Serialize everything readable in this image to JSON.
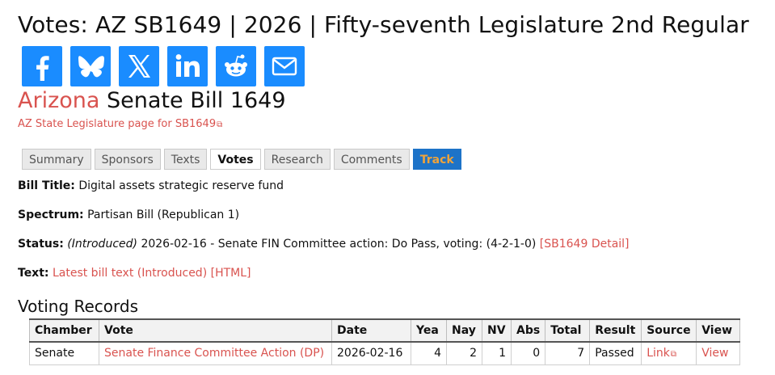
{
  "title": "Votes: AZ SB1649 | 2026 | Fifty-seventh Legislature 2nd Regular",
  "share_buttons": [
    "facebook-icon",
    "bluesky-icon",
    "x-icon",
    "linkedin-icon",
    "reddit-icon",
    "email-icon"
  ],
  "colors": {
    "share_bg": "#1a8cff",
    "link": "#d9534f",
    "track_bg": "#1d73c8",
    "track_text": "#f0a33a"
  },
  "bill": {
    "state": "Arizona",
    "name": "Senate Bill 1649",
    "legislature_link": "AZ State Legislature page for SB1649"
  },
  "tabs": {
    "summary": "Summary",
    "sponsors": "Sponsors",
    "texts": "Texts",
    "votes": "Votes",
    "research": "Research",
    "comments": "Comments",
    "track": "Track"
  },
  "fields": {
    "bill_title_label": "Bill Title:",
    "bill_title_value": "Digital assets strategic reserve fund",
    "spectrum_label": "Spectrum:",
    "spectrum_value": "Partisan Bill (Republican 1)",
    "status_label": "Status:",
    "status_stage": "(Introduced)",
    "status_text": "2026-02-16 - Senate FIN Committee action: Do Pass, voting: (4-2-1-0)",
    "status_link": "[SB1649 Detail]",
    "text_label": "Text:",
    "text_link": "Latest bill text (Introduced) [HTML]"
  },
  "voting_records": {
    "heading": "Voting Records",
    "columns": [
      "Chamber",
      "Vote",
      "Date",
      "Yea",
      "Nay",
      "NV",
      "Abs",
      "Total",
      "Result",
      "Source",
      "View"
    ],
    "rows": [
      {
        "chamber": "Senate",
        "vote": "Senate Finance Committee Action (DP)",
        "date": "2026-02-16",
        "yea": "4",
        "nay": "2",
        "nv": "1",
        "abs": "0",
        "total": "7",
        "result": "Passed",
        "source": "Link",
        "view": "View"
      }
    ]
  }
}
